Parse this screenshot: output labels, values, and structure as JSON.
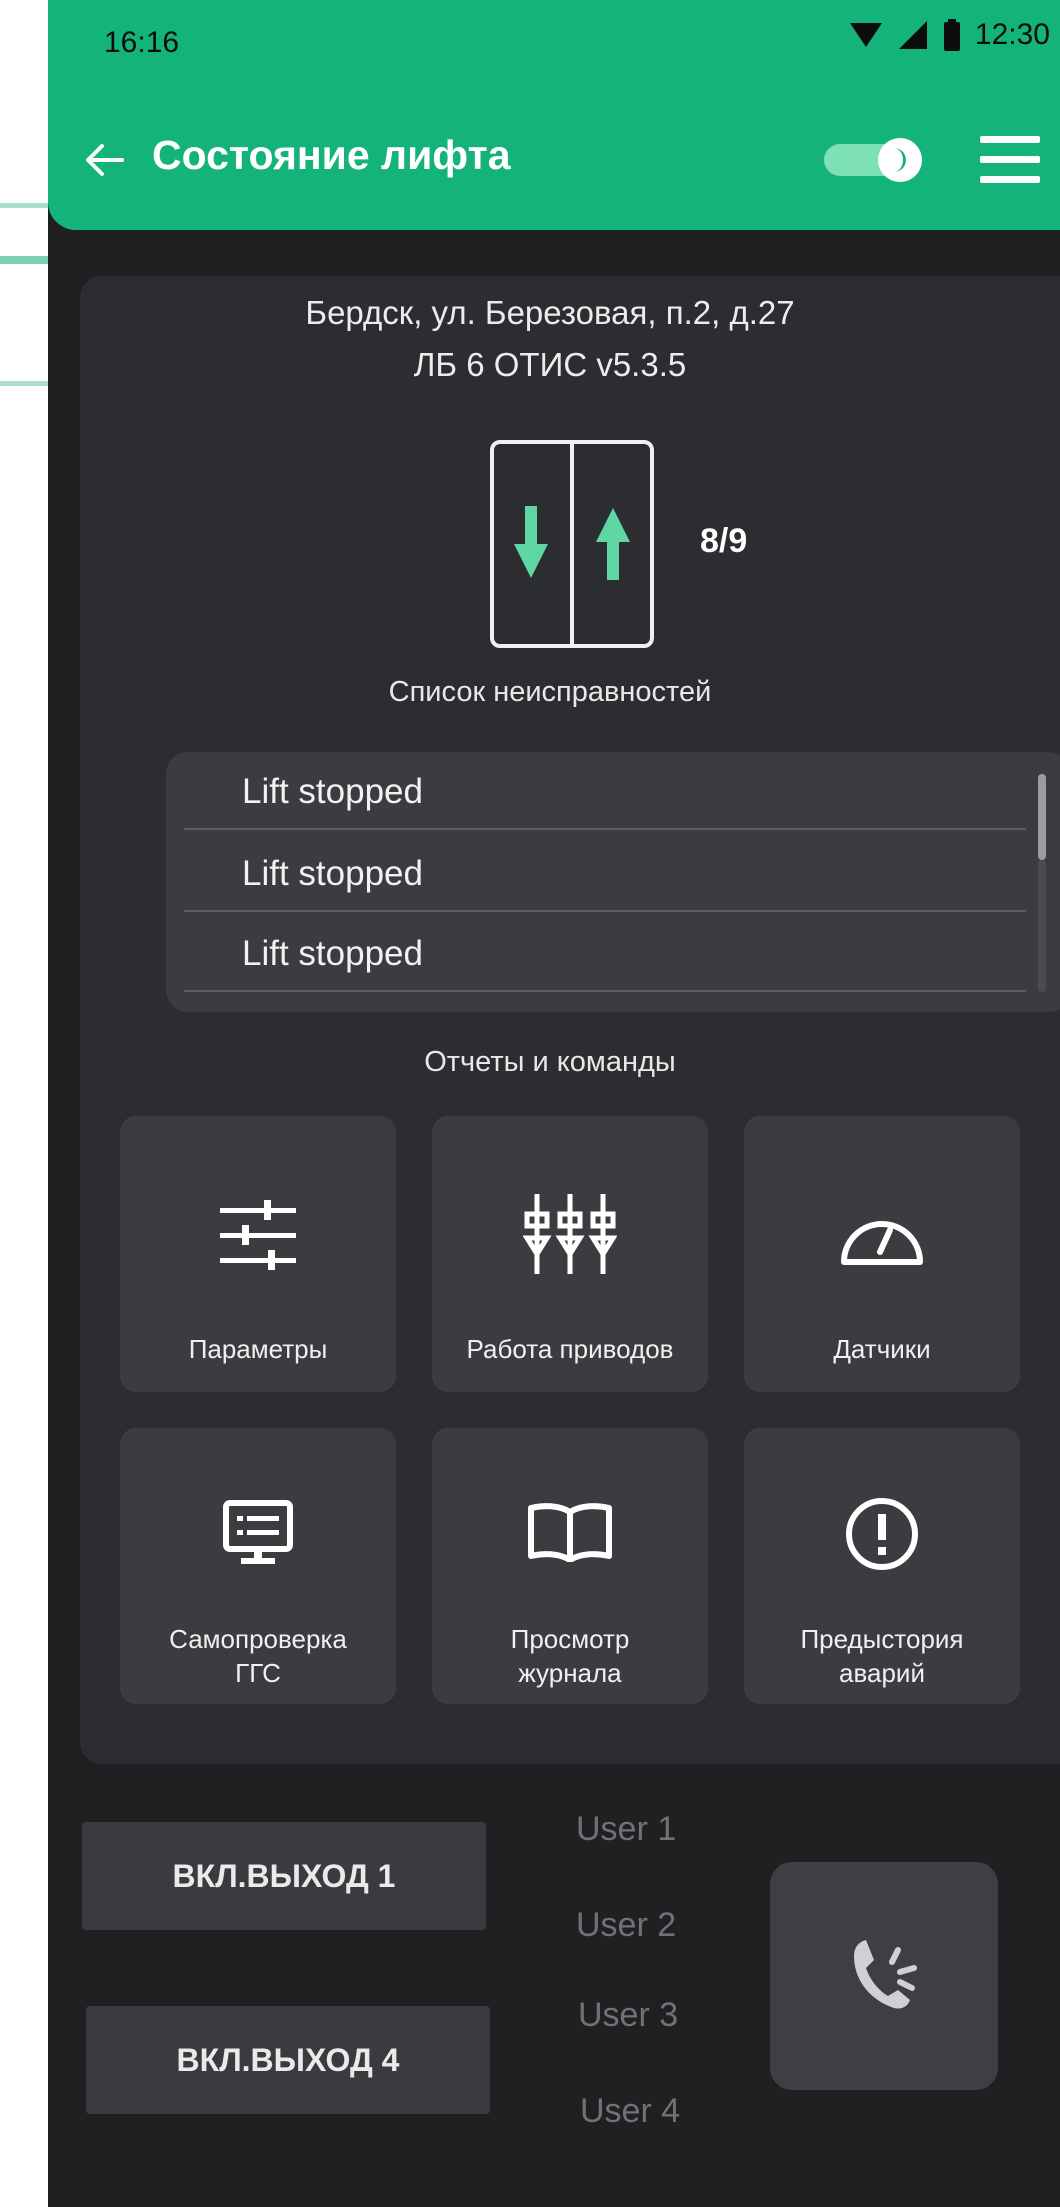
{
  "status_bar": {
    "time_left": "16:16",
    "time_right": "12:30"
  },
  "app_bar": {
    "title": "Состояние лифта"
  },
  "lift_info": {
    "address": "Бердск, ул. Березовая, п.2, д.27",
    "controller": "ЛБ 6 ОТИС v5.3.5",
    "floor": "8/9"
  },
  "faults": {
    "label": "Список неисправностей",
    "items": [
      "Lift stopped",
      "Lift stopped",
      "Lift stopped"
    ]
  },
  "reports": {
    "label": "Отчеты и команды",
    "tiles": [
      {
        "label": "Параметры",
        "icon": "sliders-icon"
      },
      {
        "label": "Работа приводов",
        "icon": "drives-icon"
      },
      {
        "label": "Датчики",
        "icon": "gauge-icon"
      },
      {
        "label": "Самопроверка ГГС",
        "icon": "monitor-icon"
      },
      {
        "label": "Просмотр журнала",
        "icon": "book-icon"
      },
      {
        "label": "Предыстория аварий",
        "icon": "alert-icon"
      }
    ]
  },
  "outputs": {
    "button1": "ВКЛ.ВЫХОД 1",
    "button4": "ВКЛ.ВЫХОД 4"
  },
  "users": [
    "User 1",
    "User 2",
    "User 3",
    "User 4"
  ],
  "colors": {
    "accent": "#14b37a",
    "arrow": "#5fd6a4",
    "background": "#1e2022",
    "card": "#2b2d30",
    "tile": "#3a3c40"
  }
}
